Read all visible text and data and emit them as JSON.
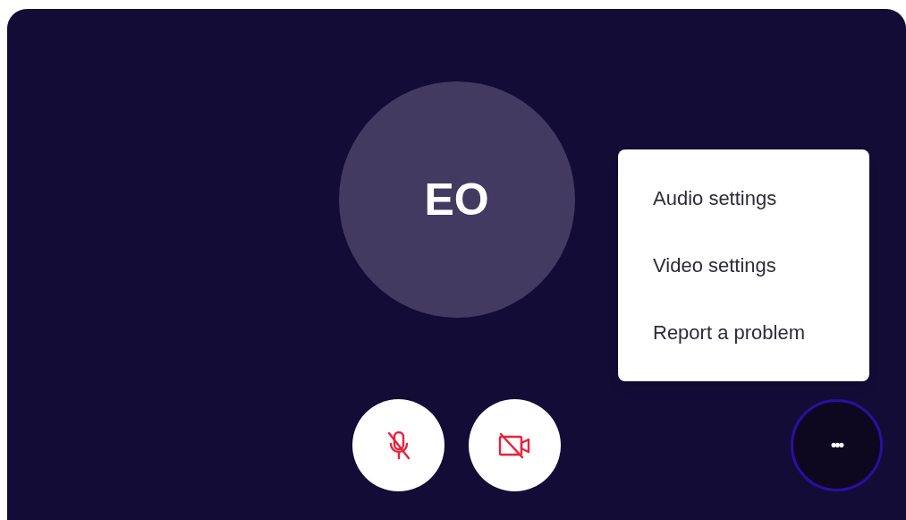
{
  "participant": {
    "initials": "EO"
  },
  "controls": [
    {
      "kind": "microphone",
      "off": true
    },
    {
      "kind": "camera",
      "off": true
    }
  ],
  "more_button": {
    "label": "•••",
    "expanded": true
  },
  "menu": {
    "items": [
      {
        "label": "Audio settings"
      },
      {
        "label": "Video settings"
      },
      {
        "label": "Report a problem"
      }
    ]
  }
}
